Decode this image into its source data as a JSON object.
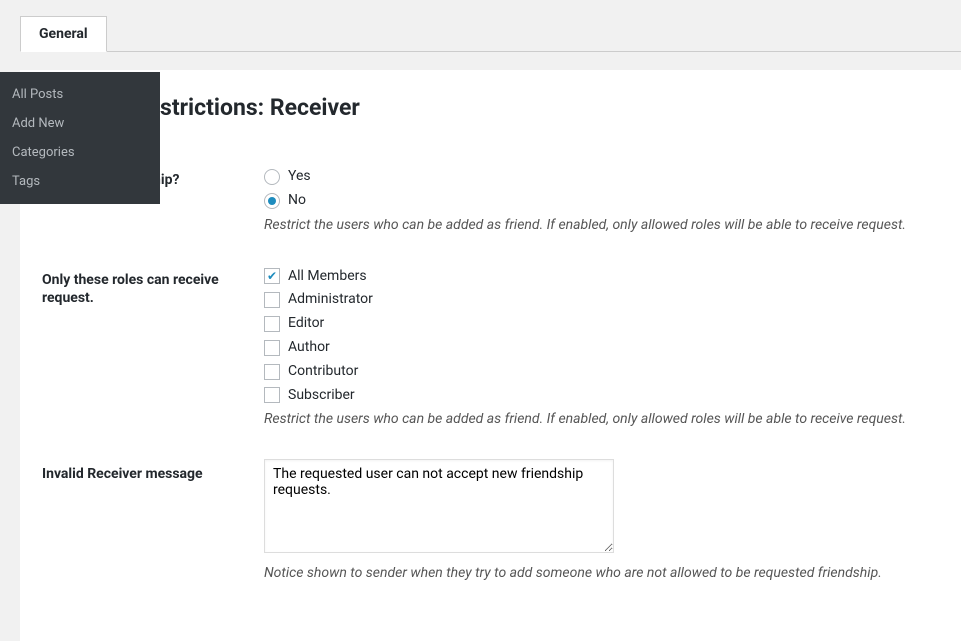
{
  "tab": {
    "label": "General"
  },
  "flyout": {
    "items": [
      {
        "label": "All Posts"
      },
      {
        "label": "Add New"
      },
      {
        "label": "Categories"
      },
      {
        "label": "Tags"
      }
    ]
  },
  "section": {
    "heading_visible": "strictions: Receiver"
  },
  "field_restrict": {
    "label_visible": "requested friendship?",
    "options": {
      "yes": "Yes",
      "no": "No"
    },
    "selected": "no",
    "desc": "Restrict the users who can be added as friend. If enabled, only allowed roles will be able to receive request."
  },
  "field_roles": {
    "label": "Only these roles can receive request.",
    "items": [
      {
        "label": "All Members",
        "checked": true
      },
      {
        "label": "Administrator",
        "checked": false
      },
      {
        "label": "Editor",
        "checked": false
      },
      {
        "label": "Author",
        "checked": false
      },
      {
        "label": "Contributor",
        "checked": false
      },
      {
        "label": "Subscriber",
        "checked": false
      }
    ],
    "desc": "Restrict the users who can be added as friend. If enabled, only allowed roles will be able to receive request."
  },
  "field_invalid": {
    "label": "Invalid Receiver message",
    "value": "The requested user can not accept new friendship requests.",
    "desc": "Notice shown to sender when they try to add someone who are not allowed to be requested friendship."
  }
}
